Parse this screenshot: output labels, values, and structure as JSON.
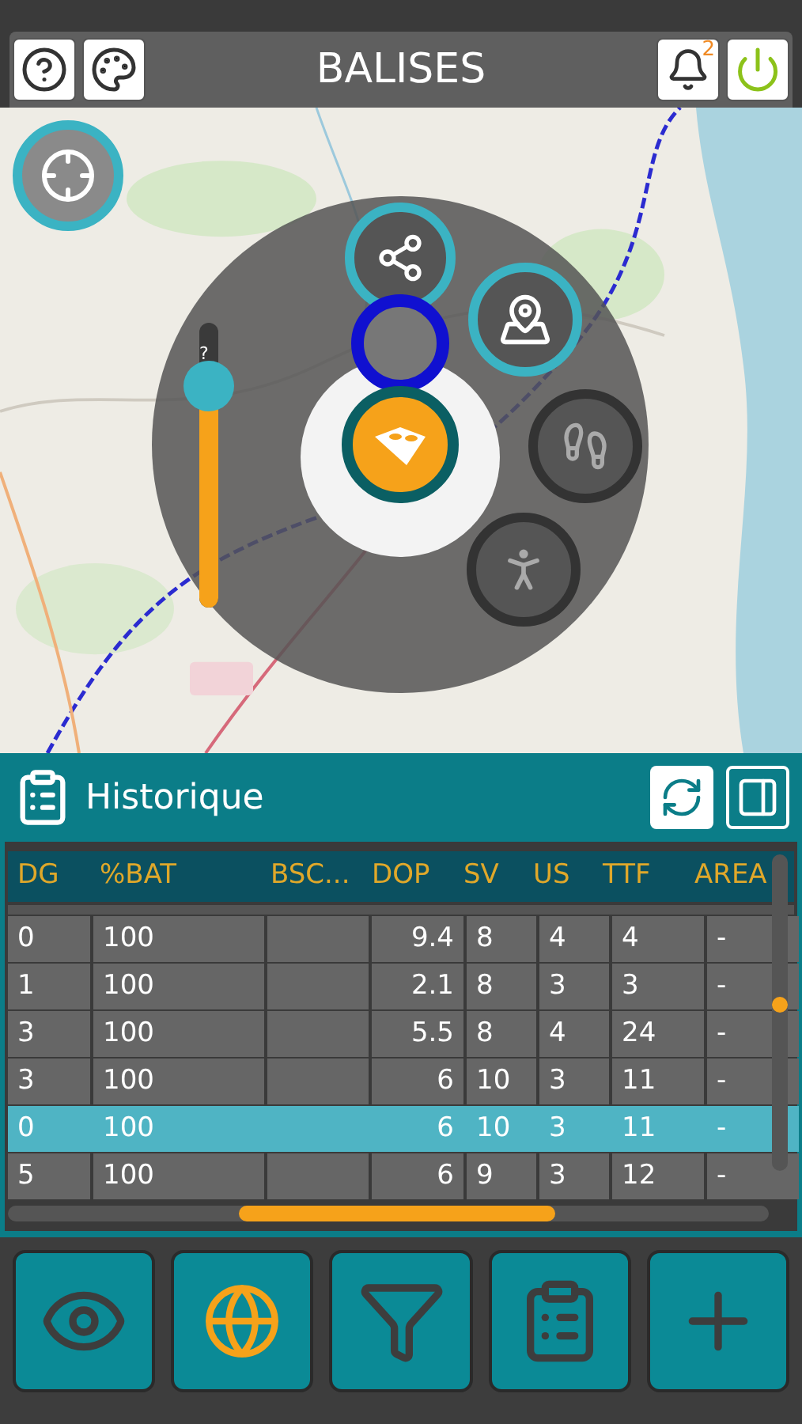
{
  "header": {
    "title": "BALISES",
    "notifications": "2"
  },
  "map": {
    "range_slider": {
      "label": "?",
      "level": 0.78
    }
  },
  "history": {
    "title": "Historique",
    "table": {
      "columns": [
        "DG",
        "%BAT",
        "BSC...",
        "DOP",
        "SV",
        "US",
        "TTF",
        "AREA"
      ],
      "rows": [
        {
          "cells": [
            "0",
            "100",
            "",
            "9.4",
            "8",
            "4",
            "4",
            "-"
          ],
          "selected": false
        },
        {
          "cells": [
            "1",
            "100",
            "",
            "2.1",
            "8",
            "3",
            "3",
            "-"
          ],
          "selected": false
        },
        {
          "cells": [
            "3",
            "100",
            "",
            "5.5",
            "8",
            "4",
            "24",
            "-"
          ],
          "selected": false
        },
        {
          "cells": [
            "3",
            "100",
            "",
            "6",
            "10",
            "3",
            "11",
            "-"
          ],
          "selected": false
        },
        {
          "cells": [
            "0",
            "100",
            "",
            "6",
            "10",
            "3",
            "11",
            "-"
          ],
          "selected": true
        },
        {
          "cells": [
            "5",
            "100",
            "",
            "6",
            "9",
            "3",
            "12",
            "-"
          ],
          "selected": false
        }
      ]
    }
  }
}
